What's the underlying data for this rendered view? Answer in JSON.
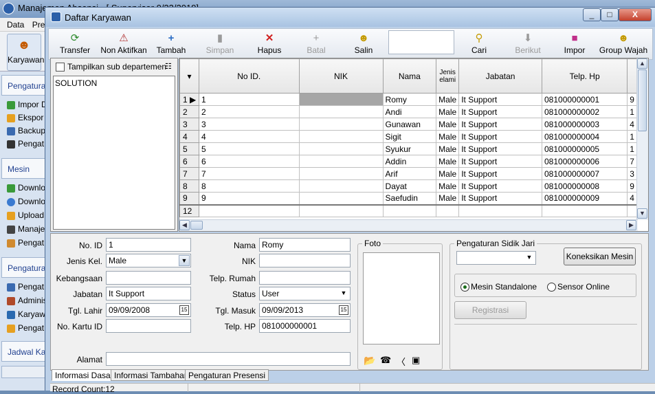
{
  "background_app": {
    "title": "Manajemen Absensi - [ Supervisor 0/23/2019]",
    "menu": [
      "Data",
      "Pre"
    ],
    "toolbar_label": "Karyawan",
    "sidebar_groups": [
      {
        "label": "Pengaturan",
        "items": [
          "Impor D",
          "Ekspor",
          "Backup",
          "Pengat"
        ]
      },
      {
        "label": "Mesin",
        "items": [
          "Downlo",
          "Downlo",
          "Upload",
          "Manaje",
          "Pengat"
        ]
      },
      {
        "label": "Pengaturan",
        "items": [
          "Pengat",
          "Adminis",
          "Karyaw",
          "Pengat"
        ]
      },
      {
        "label": "Jadwal Kar",
        "items": []
      }
    ]
  },
  "dialog": {
    "title": "Daftar Karyawan",
    "window_buttons": {
      "minimize": "_",
      "maximize": "□",
      "close": "X"
    }
  },
  "toolbar": {
    "transfer": "Transfer",
    "nonaktif": "Non Aktifkan",
    "tambah": "Tambah",
    "simpan": "Simpan",
    "hapus": "Hapus",
    "batal": "Batal",
    "salin": "Salin",
    "search_value": "",
    "cari": "Cari",
    "berikut": "Berikut",
    "impor": "Impor",
    "group_wajah": "Group Wajah"
  },
  "department": {
    "checkbox_label": "Tampilkan sub departemen",
    "checked": false,
    "items": [
      "SOLUTION"
    ]
  },
  "grid": {
    "columns": [
      "No ID.",
      "NIK",
      "Nama",
      "Jenis kelamin",
      "Jabatan",
      "Telp. Hp"
    ],
    "column_header_display": [
      "No ID.",
      "NIK",
      "Nama",
      "Jenis elami",
      "Jabatan",
      "Telp. Hp"
    ],
    "rows": [
      {
        "row": "1",
        "no_id": "1",
        "nik": "",
        "nama": "Romy",
        "jenis": "Male",
        "jabatan": "It Support",
        "telp": "081000000001",
        "extra": "9"
      },
      {
        "row": "2",
        "no_id": "2",
        "nik": "",
        "nama": "Andi",
        "jenis": "Male",
        "jabatan": "It Support",
        "telp": "081000000002",
        "extra": "1"
      },
      {
        "row": "3",
        "no_id": "3",
        "nik": "",
        "nama": "Gunawan",
        "jenis": "Male",
        "jabatan": "It Support",
        "telp": "081000000003",
        "extra": "4"
      },
      {
        "row": "4",
        "no_id": "4",
        "nik": "",
        "nama": "Sigit",
        "jenis": "Male",
        "jabatan": "It Support",
        "telp": "081000000004",
        "extra": "1"
      },
      {
        "row": "5",
        "no_id": "5",
        "nik": "",
        "nama": "Syukur",
        "jenis": "Male",
        "jabatan": "It Support",
        "telp": "081000000005",
        "extra": "1"
      },
      {
        "row": "6",
        "no_id": "6",
        "nik": "",
        "nama": "Addin",
        "jenis": "Male",
        "jabatan": "It Support",
        "telp": "081000000006",
        "extra": "7"
      },
      {
        "row": "7",
        "no_id": "7",
        "nik": "",
        "nama": "Arif",
        "jenis": "Male",
        "jabatan": "It Support",
        "telp": "081000000007",
        "extra": "3"
      },
      {
        "row": "8",
        "no_id": "8",
        "nik": "",
        "nama": "Dayat",
        "jenis": "Male",
        "jabatan": "It Support",
        "telp": "081000000008",
        "extra": "9"
      },
      {
        "row": "9",
        "no_id": "9",
        "nik": "",
        "nama": "Saefudin",
        "jenis": "Male",
        "jabatan": "It Support",
        "telp": "081000000009",
        "extra": "4"
      },
      {
        "row": "12",
        "no_id": "",
        "nik": "",
        "nama": "",
        "jenis": "",
        "jabatan": "",
        "telp": "",
        "extra": ""
      }
    ]
  },
  "form": {
    "no_id": {
      "label": "No. ID",
      "value": "1"
    },
    "jenis_kel": {
      "label": "Jenis Kel.",
      "value": "Male"
    },
    "kebangsaan": {
      "label": "Kebangsaan",
      "value": ""
    },
    "jabatan": {
      "label": "Jabatan",
      "value": "It Support"
    },
    "tgl_lahir": {
      "label": "Tgl. Lahir",
      "value": "09/09/2008"
    },
    "no_kartu": {
      "label": "No. Kartu ID",
      "value": ""
    },
    "alamat": {
      "label": "Alamat",
      "value": ""
    },
    "nama": {
      "label": "Nama",
      "value": "Romy"
    },
    "nik": {
      "label": "NIK",
      "value": ""
    },
    "telp_rumah": {
      "label": "Telp. Rumah",
      "value": ""
    },
    "status": {
      "label": "Status",
      "value": "User"
    },
    "tgl_masuk": {
      "label": "Tgl. Masuk",
      "value": "09/09/2013"
    },
    "telp_hp": {
      "label": "Telp. HP",
      "value": "081000000001"
    },
    "foto_label": "Foto",
    "sidik_jari": {
      "title": "Pengaturan Sidik Jari",
      "select_value": "",
      "connect_button": "Koneksikan Mesin",
      "radio_standalone": "Mesin Standalone",
      "radio_online": "Sensor Online",
      "registrasi": "Registrasi"
    }
  },
  "tabs": [
    "Informasi Dasar",
    "Informasi Tambahan",
    "Pengaturan Presensi"
  ],
  "status": {
    "record_count": "Record Count:12"
  }
}
